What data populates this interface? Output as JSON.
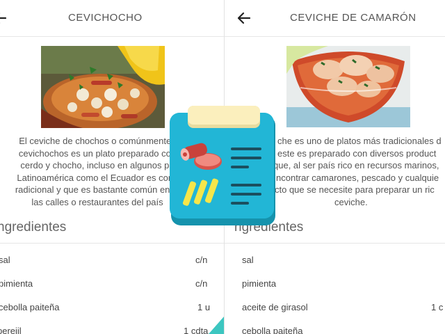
{
  "left": {
    "title": "CEVICHOCHO",
    "description_lines": [
      "El ceviche de chochos o comúnmente l",
      "cevichochos es un plato preparado con",
      "cerdo y chocho, incluso en algunos pa",
      "Latinoamérica como el Ecuador es cons",
      "radicional y que es bastante común enco",
      "las calles o restaurantes del país"
    ],
    "ingredients_title": "ngredientes",
    "ingredients": [
      {
        "name": "sal",
        "qty": "c/n"
      },
      {
        "name": "pimienta",
        "qty": "c/n"
      },
      {
        "name": "cebolla paiteña",
        "qty": "1 u"
      },
      {
        "name": "perejil",
        "qty": "1 cdta"
      }
    ]
  },
  "right": {
    "title": "CEVICHE DE CAMARÓN",
    "description_lines": [
      "che es uno de platos más tradicionales d",
      "este es preparado con diversos product",
      "que, al ser país rico en recursos marinos,",
      "ncontrar camarones, pescado y cualquie",
      "cto que se necesite para preparar un ric",
      "ceviche."
    ],
    "ingredients_title": "ngredientes",
    "ingredients": [
      {
        "name": "sal",
        "qty": ""
      },
      {
        "name": "pimienta",
        "qty": ""
      },
      {
        "name": "aceite de girasol",
        "qty": "1 c"
      },
      {
        "name": "cebolla paiteña",
        "qty": ""
      }
    ]
  },
  "icons": {
    "back": "arrow-left-icon",
    "app": "recipe-clipboard-app-icon"
  },
  "colors": {
    "app_icon_teal": "#22b6d6",
    "app_icon_clip": "#fbefbd",
    "text": "#444444",
    "divider": "#e6e6e6"
  }
}
